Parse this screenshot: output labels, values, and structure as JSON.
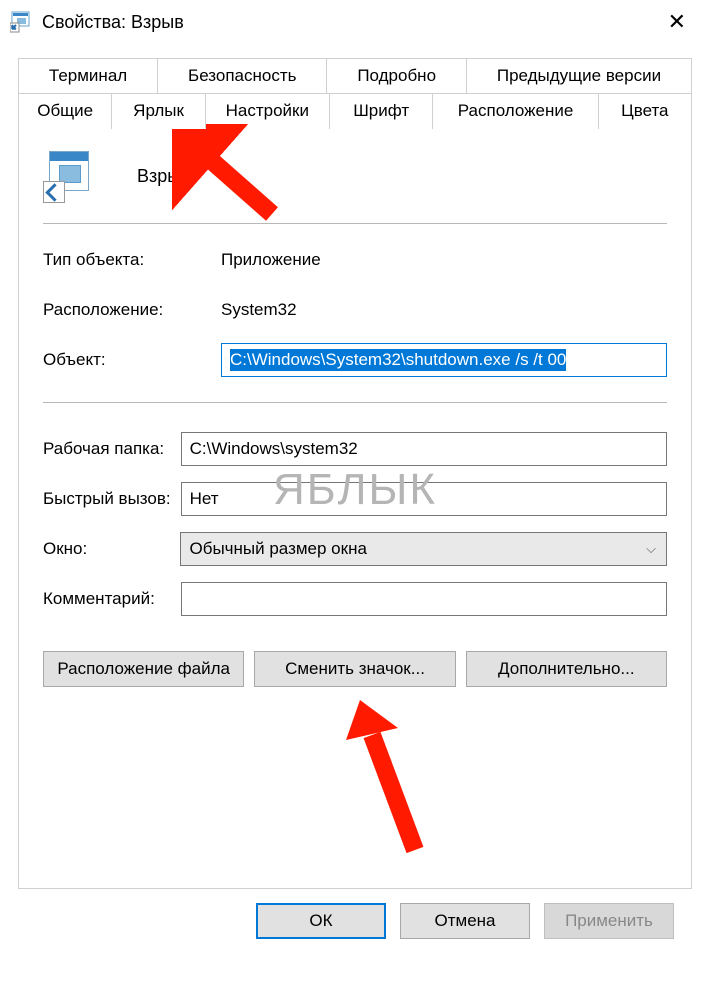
{
  "window": {
    "title": "Свойства: Взрыв"
  },
  "tabs": {
    "row1": [
      "Терминал",
      "Безопасность",
      "Подробно",
      "Предыдущие версии"
    ],
    "row2": [
      "Общие",
      "Ярлык",
      "Настройки",
      "Шрифт",
      "Расположение",
      "Цвета"
    ],
    "active": "Ярлык"
  },
  "shortcut": {
    "name": "Взрыв",
    "type_label": "Тип объекта:",
    "type_value": "Приложение",
    "location_label": "Расположение:",
    "location_value": "System32",
    "target_label": "Объект:",
    "target_value": "C:\\Windows\\System32\\shutdown.exe /s /t 00",
    "startin_label": "Рабочая папка:",
    "startin_value": "C:\\Windows\\system32",
    "hotkey_label": "Быстрый вызов:",
    "hotkey_value": "Нет",
    "run_label": "Окно:",
    "run_value": "Обычный размер окна",
    "comment_label": "Комментарий:",
    "comment_value": ""
  },
  "buttons": {
    "open_location": "Расположение файла",
    "change_icon": "Сменить значок...",
    "advanced": "Дополнительно...",
    "ok": "ОК",
    "cancel": "Отмена",
    "apply": "Применить"
  },
  "watermark": "ЯБЛЫК"
}
